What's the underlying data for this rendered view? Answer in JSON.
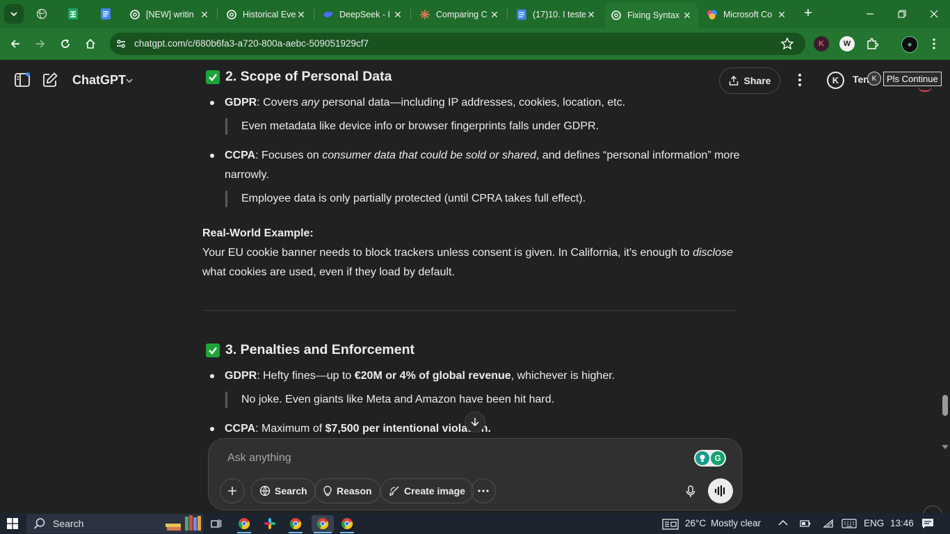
{
  "browser": {
    "tabs": [
      {
        "title": "[NEW] writin",
        "favicon": "openai-icon"
      },
      {
        "title": "Historical Eve",
        "favicon": "openai-icon"
      },
      {
        "title": "DeepSeek - I",
        "favicon": "deepseek-icon"
      },
      {
        "title": "Comparing C",
        "favicon": "claude-icon"
      },
      {
        "title": "(17)10. I teste",
        "favicon": "docs-icon"
      },
      {
        "title": "Fixing Syntax",
        "favicon": "openai-icon",
        "active": true
      },
      {
        "title": "Microsoft Co",
        "favicon": "copilot-icon"
      }
    ],
    "url": "chatgpt.com/c/680b6fa3-a720-800a-aebc-509051929cf7",
    "accent_color": "#23752f"
  },
  "app": {
    "brand": "ChatGPT",
    "share_label": "Share",
    "user_initial": "K",
    "user_name": "Ten",
    "tooltip_initial": "K",
    "tooltip_text": "Pls Continue"
  },
  "article": {
    "section2": {
      "heading": "2. Scope of Personal Data",
      "gdpr_label": "GDPR",
      "gdpr_text_1": ": Covers ",
      "gdpr_text_em": "any",
      "gdpr_text_2": " personal data—including IP addresses, cookies, location, etc.",
      "gdpr_quote": "Even metadata like device info or browser fingerprints falls under GDPR.",
      "ccpa_label": "CCPA",
      "ccpa_text_1": ": Focuses on ",
      "ccpa_text_em": "consumer data that could be sold or shared",
      "ccpa_text_2": ", and defines “personal information” more",
      "ccpa_text_3": "narrowly.",
      "ccpa_quote": "Employee data is only partially protected (until CPRA takes full effect).",
      "example_label": "Real-World Example:",
      "example_1": "Your EU cookie banner needs to block trackers unless consent is given. In California, it's enough to ",
      "example_em": "disclose",
      "example_2": "what cookies are used, even if they load by default."
    },
    "section3": {
      "heading": "3. Penalties and Enforcement",
      "gdpr_label": "GDPR",
      "gdpr_text_1": ": Hefty fines—up to ",
      "gdpr_bold": "€20M or 4% of global revenue",
      "gdpr_text_2": ", whichever is higher.",
      "gdpr_quote": "No joke. Even giants like Meta and Amazon have been hit hard.",
      "ccpa_label": "CCPA",
      "ccpa_text_1": ": Maximum of ",
      "ccpa_bold": "$7,500 per intentional violation."
    }
  },
  "composer": {
    "placeholder": "Ask anything",
    "search_label": "Search",
    "reason_label": "Reason",
    "create_image_label": "Create image"
  },
  "taskbar": {
    "search_label": "Search",
    "temperature": "26°C",
    "weather": "Mostly clear",
    "language": "ENG",
    "time": "13:46"
  }
}
